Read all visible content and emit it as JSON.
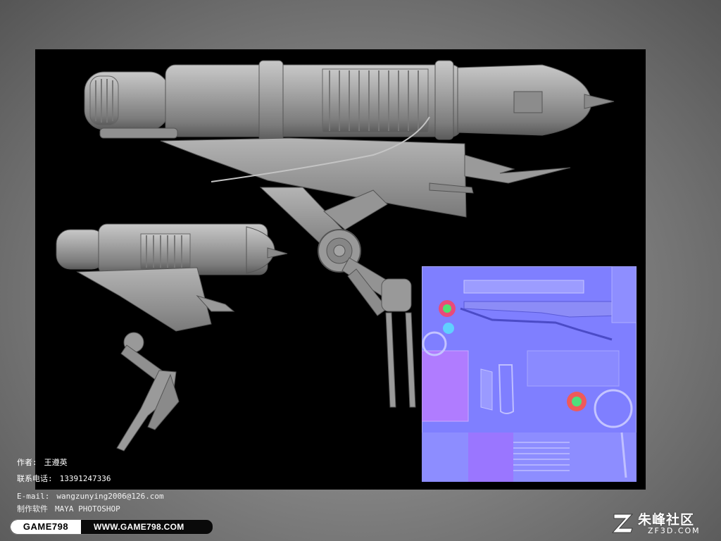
{
  "credits": {
    "author_label": "作者:",
    "author_value": "王遵英",
    "phone_label": "联系电话:",
    "phone_value": "13391247336",
    "email_label": "E-mail:",
    "email_value": "wangzunying2006@126.com",
    "software_label": "制作软件",
    "software_value": "MAYA PHOTOSHOP"
  },
  "brand_bar": {
    "name": "GAME798",
    "url": "WWW.GAME798.COM"
  },
  "watermark": {
    "name": "朱峰社区",
    "domain": "ZF3D.COM"
  },
  "colors": {
    "render_background": "#000000",
    "model_gray": "#9a9a9a",
    "normal_map_base": "#7f7fff"
  },
  "icons": {
    "weapon_model": "grey-3d-gun-render",
    "normal_map": "purple-normal-map-texture",
    "watermark_mark": "stylized-z-logo"
  }
}
